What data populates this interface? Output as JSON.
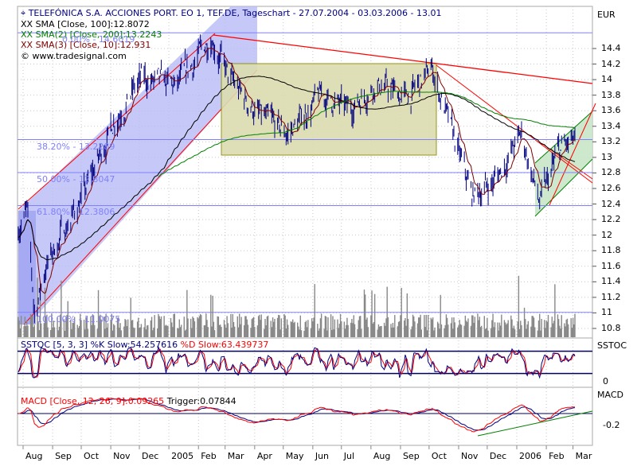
{
  "header": {
    "title": "TELEFÓNICA S.A. ACCIONES PORT. EO 1, TEF.DE, Tageschart - 27.07.2004 - 03.03.2006 - 13.01",
    "copyright": "© www.tradesignal.com"
  },
  "legend": {
    "sma1": "SMA [Close, 100]:12.8072",
    "sma2": "SMA(2) [Close, 200]:13.2243",
    "sma3": "SMA(3) [Close, 10]:12.931",
    "sstoc_k": "SSTOC [5, 3, 3] %K Slow:54.257616",
    "sstoc_d": "%D Slow:63.439737",
    "macd": "MACD [Close, 12, 26, 9]:0.09265",
    "trigger": "Trigger:0.07844"
  },
  "colors": {
    "price": "#000080",
    "sma1": "#000000",
    "sma2": "#008000",
    "sma3": "#800000",
    "fib": "#8080ff",
    "trend": "#ff0000"
  },
  "chart_data": {
    "type": "line",
    "panels": [
      "price",
      "SSTOC",
      "MACD"
    ],
    "price_axis": {
      "unit": "EUR",
      "ticks": [
        "14.4",
        "14.2",
        "14",
        "13.8",
        "13.6",
        "13.4",
        "13.2",
        "13",
        "12.8",
        "12.6",
        "12.4",
        "12.2",
        "12",
        "11.8",
        "11.6",
        "11.4",
        "11.2",
        "11",
        "10.8"
      ],
      "ylim": [
        10.7,
        14.8
      ]
    },
    "sstoc_axis": {
      "label": "SSTOC",
      "ticks": [
        "0"
      ],
      "levels": [
        20,
        80
      ]
    },
    "macd_axis": {
      "label": "MACD",
      "ticks": [
        "-0.2"
      ]
    },
    "x_ticks": [
      {
        "label": "Aug",
        "date": "2004-08-01"
      },
      {
        "label": "Sep",
        "date": "2004-09-01"
      },
      {
        "label": "Oct",
        "date": "2004-10-01"
      },
      {
        "label": "Nov",
        "date": "2004-11-01"
      },
      {
        "label": "Dec",
        "date": "2004-12-01"
      },
      {
        "label": "2005",
        "date": "2005-01-01"
      },
      {
        "label": "Feb",
        "date": "2005-02-01"
      },
      {
        "label": "Mar",
        "date": "2005-03-01"
      },
      {
        "label": "Apr",
        "date": "2005-04-01"
      },
      {
        "label": "May",
        "date": "2005-05-01"
      },
      {
        "label": "Jun",
        "date": "2005-06-01"
      },
      {
        "label": "Jul",
        "date": "2005-07-01"
      },
      {
        "label": "Aug",
        "date": "2005-08-01"
      },
      {
        "label": "Sep",
        "date": "2005-09-01"
      },
      {
        "label": "Oct",
        "date": "2005-10-01"
      },
      {
        "label": "Nov",
        "date": "2005-11-01"
      },
      {
        "label": "Dec",
        "date": "2005-12-01"
      },
      {
        "label": "2006",
        "date": "2006-01-01"
      },
      {
        "label": "Feb",
        "date": "2006-02-01"
      },
      {
        "label": "Mar",
        "date": "2006-03-01"
      }
    ],
    "xlim": [
      "2004-07-27",
      "2006-03-03"
    ],
    "close_keypoints": [
      [
        "2004-07-27",
        12.1
      ],
      [
        "2004-08-05",
        12.3
      ],
      [
        "2004-08-13",
        11.0
      ],
      [
        "2004-08-25",
        11.6
      ],
      [
        "2004-09-08",
        11.95
      ],
      [
        "2004-10-05",
        12.55
      ],
      [
        "2004-11-05",
        13.5
      ],
      [
        "2004-12-03",
        14.0
      ],
      [
        "2005-01-10",
        13.9
      ],
      [
        "2005-02-15",
        14.56
      ],
      [
        "2005-03-05",
        14.0
      ],
      [
        "2005-04-08",
        13.5
      ],
      [
        "2005-05-06",
        13.3
      ],
      [
        "2005-06-10",
        13.8
      ],
      [
        "2005-07-08",
        13.6
      ],
      [
        "2005-08-05",
        13.95
      ],
      [
        "2005-09-09",
        13.75
      ],
      [
        "2005-10-04",
        14.15
      ],
      [
        "2005-10-28",
        13.2
      ],
      [
        "2005-11-15",
        12.5
      ],
      [
        "2005-12-09",
        12.7
      ],
      [
        "2006-01-06",
        13.3
      ],
      [
        "2006-01-25",
        12.4
      ],
      [
        "2006-02-15",
        13.1
      ],
      [
        "2006-03-03",
        13.2
      ]
    ],
    "fibonacci": [
      {
        "label": "0.00% - 14.6019",
        "value": 14.6019
      },
      {
        "label": "38.20% - 13.2289",
        "value": 13.2289
      },
      {
        "label": "50.00% - 12.8047",
        "value": 12.8047
      },
      {
        "label": "61.80% - 12.3806",
        "value": 12.3806
      },
      {
        "label": "100.00% - 11.0075",
        "value": 11.0075
      }
    ],
    "grid": true
  }
}
